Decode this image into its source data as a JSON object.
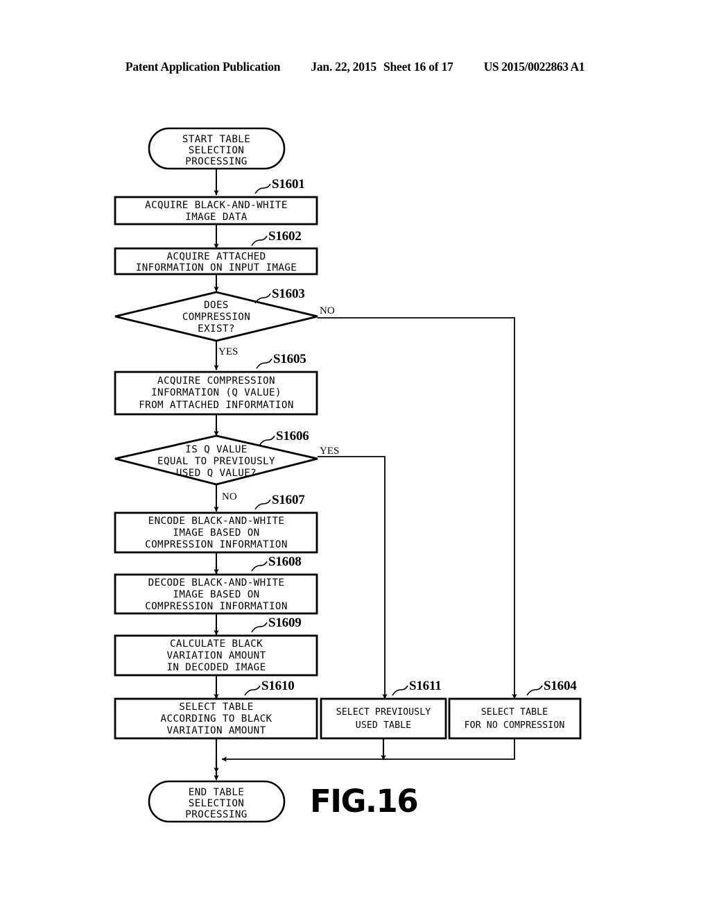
{
  "header": {
    "publication": "Patent Application Publication",
    "date": "Jan. 22, 2015",
    "sheet": "Sheet 16 of 17",
    "patent_number": "US 2015/0022863 A1"
  },
  "figure": {
    "label": "FIG.16",
    "type": "flowchart",
    "title": "START TABLE SELECTION PROCESSING"
  },
  "nodes": {
    "start": {
      "shape": "terminator",
      "lines": [
        "START TABLE",
        "SELECTION",
        "PROCESSING"
      ]
    },
    "s1601": {
      "shape": "process",
      "step": "S1601",
      "lines": [
        "ACQUIRE BLACK-AND-WHITE",
        "IMAGE DATA"
      ]
    },
    "s1602": {
      "shape": "process",
      "step": "S1602",
      "lines": [
        "ACQUIRE ATTACHED",
        "INFORMATION ON INPUT IMAGE"
      ]
    },
    "s1603": {
      "shape": "decision",
      "step": "S1603",
      "lines": [
        "DOES",
        "COMPRESSION",
        "EXIST?"
      ]
    },
    "s1605": {
      "shape": "process",
      "step": "S1605",
      "lines": [
        "ACQUIRE COMPRESSION",
        "INFORMATION (Q VALUE)",
        "FROM ATTACHED INFORMATION"
      ]
    },
    "s1606": {
      "shape": "decision",
      "step": "S1606",
      "lines": [
        "IS Q VALUE",
        "EQUAL TO PREVIOUSLY",
        "USED Q VALUE?"
      ]
    },
    "s1607": {
      "shape": "process",
      "step": "S1607",
      "lines": [
        "ENCODE BLACK-AND-WHITE",
        "IMAGE BASED ON",
        "COMPRESSION INFORMATION"
      ]
    },
    "s1608": {
      "shape": "process",
      "step": "S1608",
      "lines": [
        "DECODE BLACK-AND-WHITE",
        "IMAGE BASED ON",
        "COMPRESSION INFORMATION"
      ]
    },
    "s1609": {
      "shape": "process",
      "step": "S1609",
      "lines": [
        "CALCULATE BLACK",
        "VARIATION AMOUNT",
        "IN DECODED IMAGE"
      ]
    },
    "s1610": {
      "shape": "process",
      "step": "S1610",
      "lines": [
        "SELECT TABLE",
        "ACCORDING TO BLACK",
        "VARIATION AMOUNT"
      ]
    },
    "s1611": {
      "shape": "process",
      "step": "S1611",
      "lines": [
        "SELECT PREVIOUSLY",
        "USED TABLE"
      ]
    },
    "s1604": {
      "shape": "process",
      "step": "S1604",
      "lines": [
        "SELECT TABLE",
        "FOR NO COMPRESSION"
      ]
    },
    "end": {
      "shape": "terminator",
      "lines": [
        "END TABLE",
        "SELECTION",
        "PROCESSING"
      ]
    }
  },
  "branches": {
    "s1603_no": "NO",
    "s1603_yes": "YES",
    "s1606_yes": "YES",
    "s1606_no": "NO"
  },
  "colors": {
    "ink": "#000000",
    "paper": "#ffffff"
  }
}
